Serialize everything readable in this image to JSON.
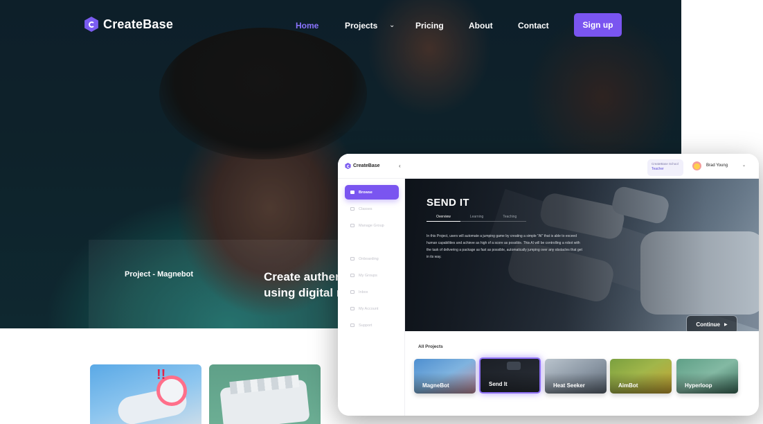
{
  "site": {
    "brand": "CreateBase",
    "nav": [
      {
        "label": "Home",
        "active": true
      },
      {
        "label": "Projects",
        "active": false
      },
      {
        "label": "Pricing",
        "active": false
      },
      {
        "label": "About",
        "active": false
      },
      {
        "label": "Contact",
        "active": false
      }
    ],
    "signup_label": "Sign up",
    "hero_project": "Project - Magnebot",
    "hero_tagline_line1": "Create authen",
    "hero_tagline_line2": "using digital r",
    "accent_color": "#7a55f0"
  },
  "app": {
    "brand": "CreateBase",
    "collapse_icon": "chevron-left-icon",
    "role": {
      "school": "CreateBase School",
      "role": "Teacher"
    },
    "user": {
      "name": "Brad Young"
    },
    "sidebar": [
      {
        "label": "Browse",
        "icon": "browse-icon",
        "active": true
      },
      {
        "label": "Classes",
        "icon": "classes-icon",
        "active": false
      },
      {
        "label": "Manage Group",
        "icon": "manage-group-icon",
        "active": false
      },
      {
        "label": "Onboarding",
        "icon": "onboarding-icon",
        "active": false
      },
      {
        "label": "My Groups",
        "icon": "groups-icon",
        "active": false
      },
      {
        "label": "Inbox",
        "icon": "inbox-icon",
        "active": false
      },
      {
        "label": "My Account",
        "icon": "account-icon",
        "active": false
      },
      {
        "label": "Support",
        "icon": "support-icon",
        "active": false
      }
    ],
    "project": {
      "title": "SEND IT",
      "tabs": [
        {
          "label": "Overview",
          "active": true
        },
        {
          "label": "Learning",
          "active": false
        },
        {
          "label": "Teaching",
          "active": false
        }
      ],
      "description": "In this Project, users will automate a jumping game by creating a simple \"AI\" that is able to exceed human capabilities and achieve as high of a score as possible. This AI will be controlling a robot with the task of delivering a package as fast as possible, automatically jumping over any obstacles that get in its way.",
      "continue_label": "Continue"
    },
    "all_projects_label": "All Projects",
    "projects": [
      {
        "name": "MagneBot",
        "selected": false
      },
      {
        "name": "Send It",
        "selected": true
      },
      {
        "name": "Heat Seeker",
        "selected": false
      },
      {
        "name": "AimBot",
        "selected": false
      },
      {
        "name": "Hyperloop",
        "selected": false
      }
    ]
  }
}
